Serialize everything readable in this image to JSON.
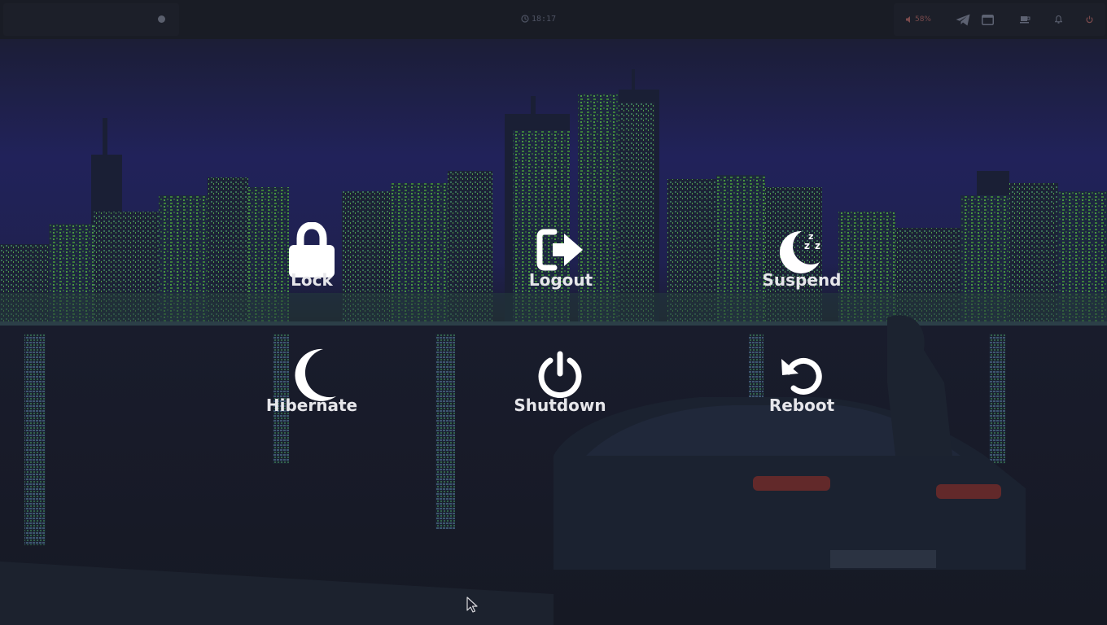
{
  "topbar": {
    "clock_time": "18:17",
    "volume_percent": "58%",
    "icons": [
      "clock-icon",
      "volume-icon",
      "telegram-icon",
      "window-icon",
      "coffee-icon",
      "bell-icon",
      "power-icon"
    ]
  },
  "power_menu": {
    "options": [
      {
        "id": "lock",
        "label": "Lock",
        "icon": "lock-icon"
      },
      {
        "id": "logout",
        "label": "Logout",
        "icon": "logout-icon"
      },
      {
        "id": "suspend",
        "label": "Suspend",
        "icon": "suspend-icon"
      },
      {
        "id": "hibernate",
        "label": "Hibernate",
        "icon": "moon-icon"
      },
      {
        "id": "shutdown",
        "label": "Shutdown",
        "icon": "power-icon"
      },
      {
        "id": "reboot",
        "label": "Reboot",
        "icon": "reboot-icon"
      }
    ],
    "label_color": "#e6e6ea"
  },
  "colors": {
    "sky_top": "#1a1d2a",
    "sky_mid": "#1e1f55",
    "building_green": "#3f8a3a",
    "water": "#181b28",
    "taillight": "#a03a3a"
  }
}
